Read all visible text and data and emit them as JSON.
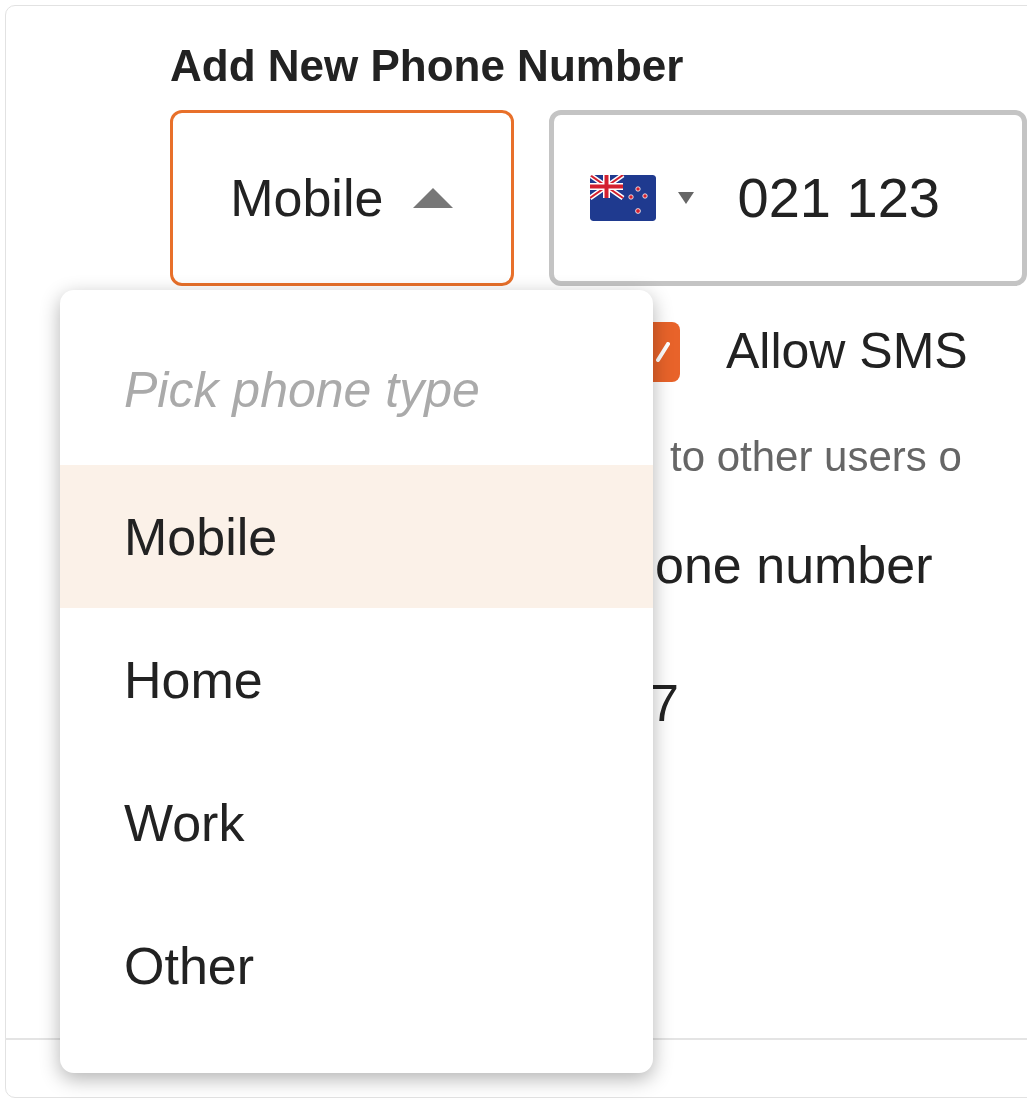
{
  "title": "Add New Phone Number",
  "phone_type_select": {
    "value": "Mobile",
    "expanded": true
  },
  "phone_field": {
    "value": "021 123"
  },
  "allow_sms": {
    "label": "Allow SMS",
    "checked": true
  },
  "hint": "to other users o",
  "row_3": "one number",
  "row_4": "7",
  "dropdown": {
    "header": "Pick phone type",
    "options": [
      {
        "label": "Mobile",
        "selected": true
      },
      {
        "label": "Home",
        "selected": false
      },
      {
        "label": "Work",
        "selected": false
      },
      {
        "label": "Other",
        "selected": false
      }
    ]
  }
}
